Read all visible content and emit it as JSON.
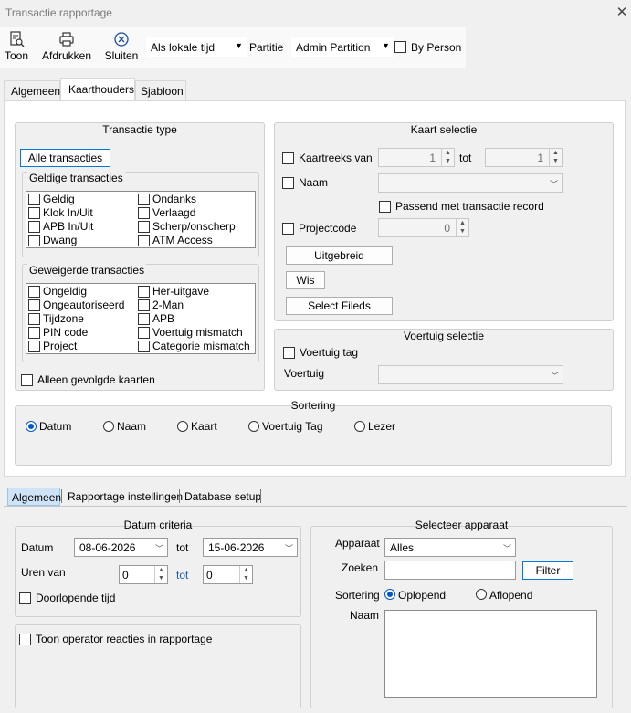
{
  "window": {
    "title": "Transactie rapportage"
  },
  "toolbar": {
    "show_label": "Toon",
    "print_label": "Afdrukken",
    "close_label": "Sluiten",
    "time_mode": "Als lokale tijd",
    "partition_label": "Partitie",
    "partition_value": "Admin Partition",
    "by_person_label": "By Person"
  },
  "top_tabs": [
    "Algemeen",
    "Kaarthouders",
    "Sjabloon"
  ],
  "transaction_type": {
    "title": "Transactie type",
    "all_button": "Alle transacties",
    "valid_title": "Geldige transacties",
    "valid_left": [
      "Geldig",
      "Klok In/Uit",
      "APB In/Uit",
      "Dwang"
    ],
    "valid_right": [
      "Ondanks",
      "Verlaagd",
      "Scherp/onscherp",
      "ATM Access"
    ],
    "refused_title": "Geweigerde transacties",
    "refused_left": [
      "Ongeldig",
      "Ongeautoriseerd",
      "Tijdzone",
      "PIN code",
      "Project"
    ],
    "refused_right": [
      "Her-uitgave",
      "2-Man",
      "APB",
      "Voertuig mismatch",
      "Categorie mismatch"
    ],
    "tracked_only": "Alleen gevolgde kaarten"
  },
  "card_selection": {
    "title": "Kaart selectie",
    "range_label": "Kaartreeks van",
    "range_from": "1",
    "range_to_label": "tot",
    "range_to": "1",
    "name_label": "Naam",
    "match_label": "Passend met transactie record",
    "project_label": "Projectcode",
    "project_value": "0",
    "extended_button": "Uitgebreid",
    "clear_button": "Wis",
    "select_fields_button": "Select Fileds"
  },
  "vehicle_selection": {
    "title": "Voertuig selectie",
    "tag_label": "Voertuig tag",
    "vehicle_label": "Voertuig"
  },
  "sorting": {
    "title": "Sortering",
    "options": [
      "Datum",
      "Naam",
      "Kaart",
      "Voertuig Tag",
      "Lezer"
    ],
    "selected": "Datum"
  },
  "bottom_tabs": [
    "Algemeen",
    "Rapportage instellingen",
    "Database setup"
  ],
  "date_criteria": {
    "title": "Datum criteria",
    "date_label": "Datum",
    "date_from": "08-06-2026",
    "date_to_label": "tot",
    "date_to": "15-06-2026",
    "hours_label": "Uren van",
    "hours_from": "0",
    "hours_to_label": "tot",
    "hours_to": "0",
    "continuous_label": "Doorlopende tijd"
  },
  "operator": {
    "label": "Toon operator reacties in rapportage"
  },
  "device_select": {
    "title": "Selecteer apparaat",
    "device_label": "Apparaat",
    "device_value": "Alles",
    "search_label": "Zoeken",
    "search_value": "",
    "filter_button": "Filter",
    "sort_label": "Sortering",
    "asc_label": "Oplopend",
    "desc_label": "Aflopend",
    "name_label": "Naam"
  },
  "colors": {
    "accent": "#0078d7",
    "tab_link": "#1a5fb4"
  }
}
